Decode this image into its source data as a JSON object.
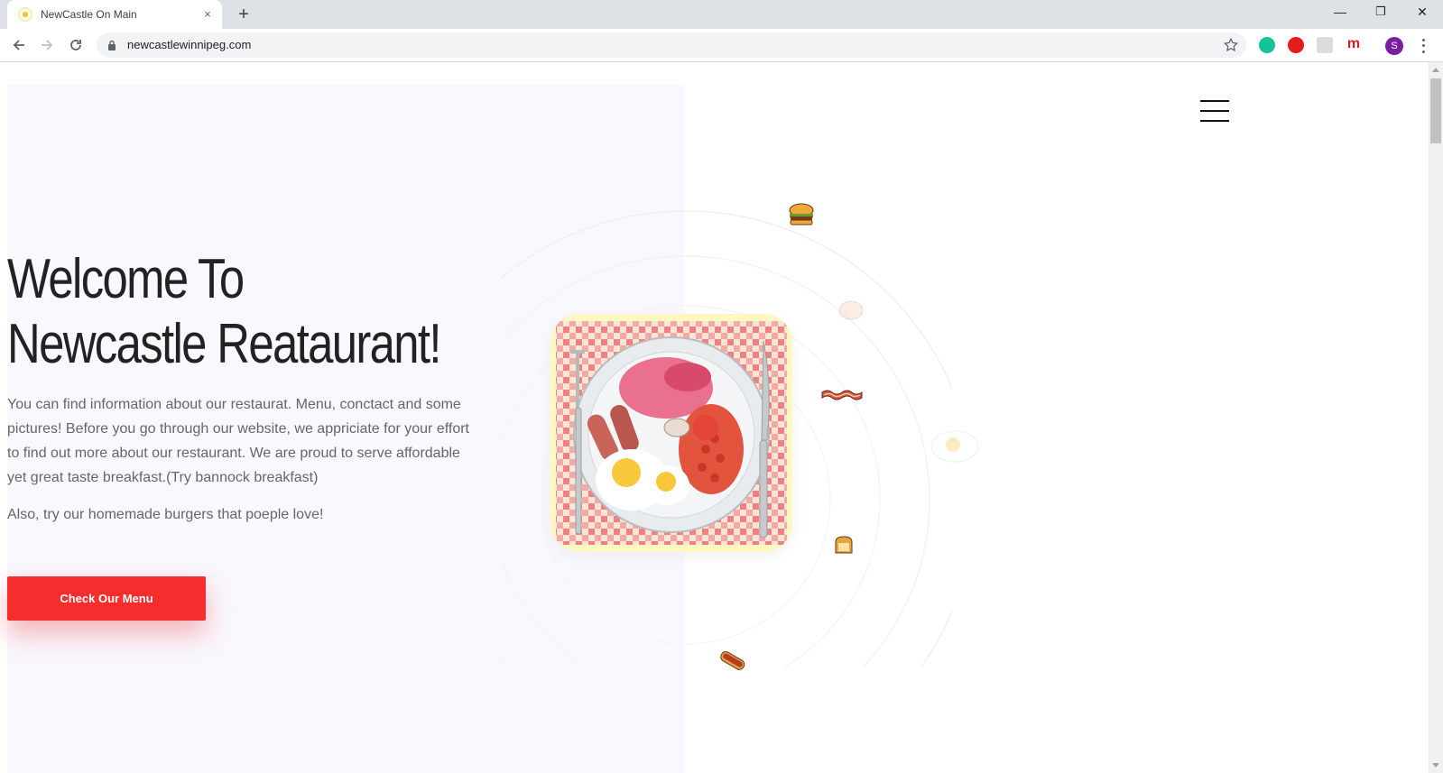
{
  "browser": {
    "tab_title": "NewCastle On Main",
    "tab_close": "×",
    "new_tab": "+",
    "url": "newcastlewinnipeg.com",
    "profile_initial": "S",
    "window_controls": {
      "minimize": "—",
      "restore": "❐",
      "close": "✕"
    }
  },
  "hero": {
    "title_line1": "Welcome To",
    "title_line2": "Newcastle Reataurant!",
    "paragraph1": "You can find information about our restaurat. Menu, conctact and some pictures! Before you go through our website, we appriciate for your effort to find out more about our restaurant. We are proud to serve affordable yet great taste breakfast.(Try bannock breakfast)",
    "paragraph2": "Also, try our homemade burgers that poeple love!",
    "cta_label": "Check Our Menu"
  },
  "icons": [
    "hamburger-menu-icon",
    "burger-icon",
    "chicken-icon",
    "bacon-icon",
    "fried-egg-icon",
    "toast-icon",
    "hotdog-icon",
    "full-breakfast-plate-image"
  ],
  "colors": {
    "accent": "#f52d2d",
    "left_panel_bg": "#f8f8fe",
    "title": "#222222",
    "body_text": "#666666",
    "image_bg": "#fdf8c2"
  }
}
